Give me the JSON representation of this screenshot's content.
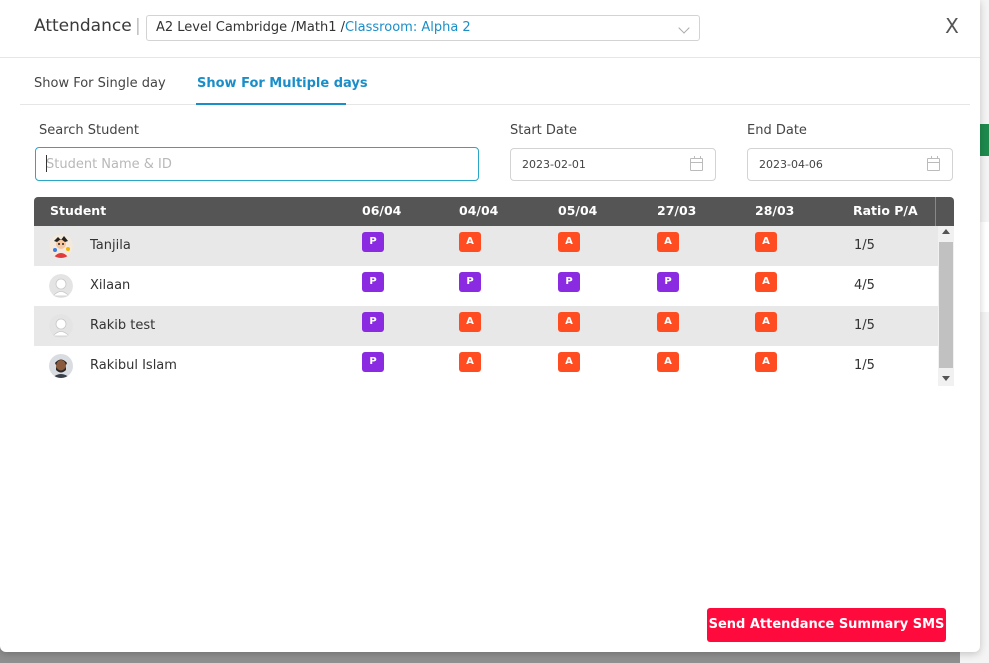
{
  "colors": {
    "accent": "#1a8ec9",
    "present": "#8a2be2",
    "absent": "#ff4d21",
    "header_bg": "#555555",
    "sms_button": "#ff0a3c"
  },
  "header": {
    "title": "Attendance",
    "separator": "|",
    "breadcrumb_prefix": "A2 Level Cambridge /Math1 /",
    "breadcrumb_class": "Classroom: Alpha 2",
    "close_label": "X"
  },
  "tabs": [
    {
      "label": "Show For Single day",
      "active": false
    },
    {
      "label": "Show For Multiple days",
      "active": true
    }
  ],
  "filters": {
    "search_label": "Search Student",
    "search_placeholder": "Student Name & ID",
    "search_value": "",
    "start_label": "Start Date",
    "start_value": "2023-02-01",
    "end_label": "End Date",
    "end_value": "2023-04-06"
  },
  "table": {
    "columns": [
      "Student",
      "06/04",
      "04/04",
      "05/04",
      "27/03",
      "28/03",
      "Ratio P/A"
    ],
    "rows": [
      {
        "name": "Tanjila",
        "avatar": "cartoon-avatar",
        "marks": [
          "P",
          "A",
          "A",
          "A",
          "A"
        ],
        "ratio": "1/5"
      },
      {
        "name": "Xilaan",
        "avatar": "default-avatar",
        "marks": [
          "P",
          "P",
          "P",
          "P",
          "A"
        ],
        "ratio": "4/5"
      },
      {
        "name": "Rakib test",
        "avatar": "default-avatar",
        "marks": [
          "P",
          "A",
          "A",
          "A",
          "A"
        ],
        "ratio": "1/5"
      },
      {
        "name": "Rakibul Islam",
        "avatar": "photo-avatar",
        "marks": [
          "P",
          "A",
          "A",
          "A",
          "A"
        ],
        "ratio": "1/5"
      }
    ]
  },
  "footer": {
    "sms_button": "Send Attendance Summary SMS"
  }
}
